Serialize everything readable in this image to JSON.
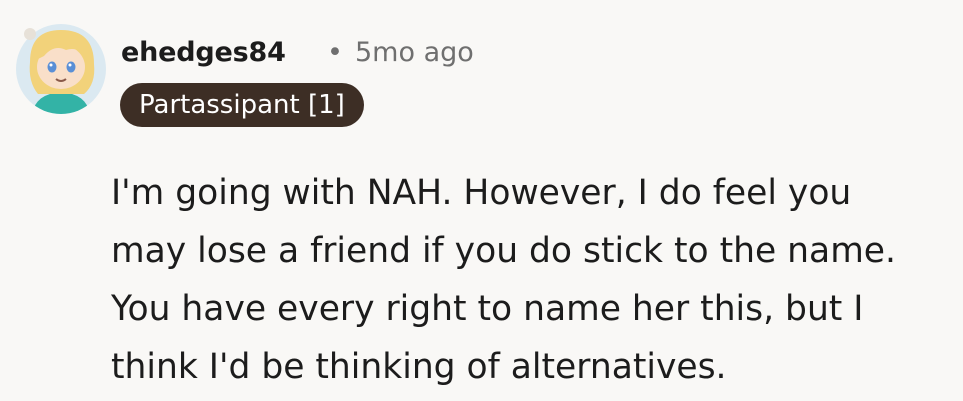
{
  "comment": {
    "avatar_icon": "user-avatar-cartoon",
    "username": "ehedges84",
    "separator": "•",
    "timestamp": "5mo ago",
    "flair": "Partassipant [1]",
    "body_lines": [
      "I'm going with NAH. However, I do feel you",
      "may lose a friend if you do stick to the name.",
      "You have every right to name her this, but I",
      "think I'd be thinking of alternatives."
    ]
  },
  "colors": {
    "background": "#f9f8f6",
    "flair_background": "#3d2e25",
    "flair_text": "#ffffff",
    "meta_text": "#6f6f6f"
  }
}
